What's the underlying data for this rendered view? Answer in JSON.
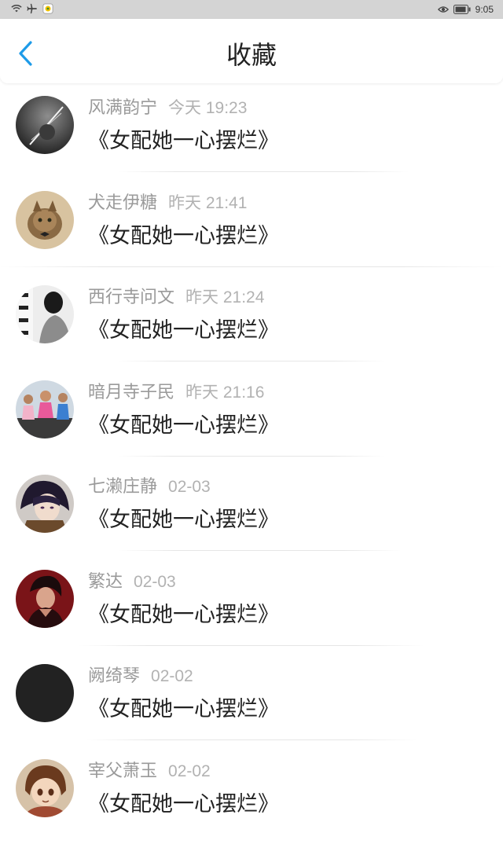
{
  "status_bar": {
    "time": "9:05"
  },
  "header": {
    "title": "收藏",
    "back_icon": "chevron-left-icon",
    "accent_color": "#1e9be8"
  },
  "items": [
    {
      "name": "风满韵宁",
      "time": "今天 19:23",
      "title": "《女配她一心摆烂》",
      "avatar": "photo"
    },
    {
      "name": "犬走伊糖",
      "time": "昨天 21:41",
      "title": "《女配她一心摆烂》",
      "avatar": "photo"
    },
    {
      "name": "西行寺问文",
      "time": "昨天 21:24",
      "title": "《女配她一心摆烂》",
      "avatar": "photo"
    },
    {
      "name": "暗月寺子民",
      "time": "昨天 21:16",
      "title": "《女配她一心摆烂》",
      "avatar": "photo"
    },
    {
      "name": "七濑庄静",
      "time": "02-03",
      "title": "《女配她一心摆烂》",
      "avatar": "photo"
    },
    {
      "name": "繁达",
      "time": "02-03",
      "title": "《女配她一心摆烂》",
      "avatar": "photo"
    },
    {
      "name": "阙绮琴",
      "time": "02-02",
      "title": "《女配她一心摆烂》",
      "avatar": "black"
    },
    {
      "name": "宰父萧玉",
      "time": "02-02",
      "title": "《女配她一心摆烂》",
      "avatar": "photo"
    }
  ]
}
